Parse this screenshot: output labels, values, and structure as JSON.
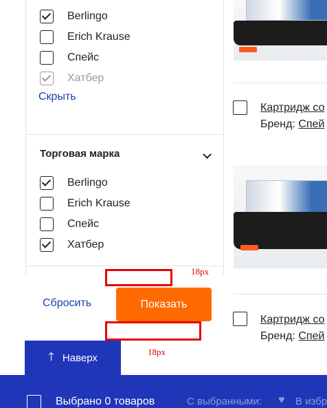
{
  "filter_top": {
    "items": [
      {
        "label": "Berlingo",
        "checked": true
      },
      {
        "label": "Erich Krause",
        "checked": false
      },
      {
        "label": "Спейс",
        "checked": false
      },
      {
        "label": "Хатбер",
        "checked": true
      }
    ],
    "hide_link": "Скрыть"
  },
  "filter_section": {
    "title": "Торговая марка",
    "items": [
      {
        "label": "Berlingo",
        "checked": true
      },
      {
        "label": "Erich Krause",
        "checked": false
      },
      {
        "label": "Спейс",
        "checked": false
      },
      {
        "label": "Хатбер",
        "checked": true
      }
    ]
  },
  "actions": {
    "reset_label": "Сбросить",
    "show_label": "Показать",
    "spacing_top_label": "18px",
    "spacing_bottom_label": "18px"
  },
  "products": [
    {
      "title": "Картридж со",
      "brand_label": "Бренд:",
      "brand_value": "Спей"
    },
    {
      "title": "Картридж со",
      "brand_label": "Бренд:",
      "brand_value": "Спей"
    }
  ],
  "scroll_top": {
    "label": "Наверх",
    "icon": "arrow-up-icon"
  },
  "bottom_bar": {
    "selected_count": "Выбрано 0 товаров",
    "with_selected": "С выбранными:",
    "favorites": "В избр",
    "icon": "heart-icon"
  },
  "colors": {
    "accent": "#ff6a00",
    "primary": "#2036b8",
    "link": "#1a3fa8",
    "measure": "#e60000"
  }
}
